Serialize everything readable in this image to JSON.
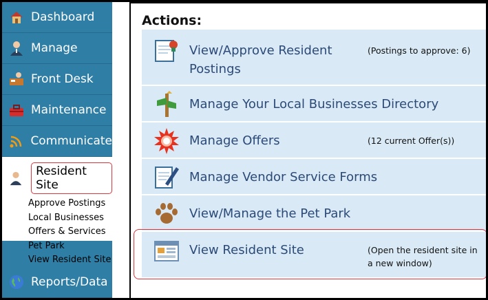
{
  "sidebar": {
    "items": [
      {
        "label": "Dashboard",
        "icon": "house-icon"
      },
      {
        "label": "Manage",
        "icon": "person-icon"
      },
      {
        "label": "Front Desk",
        "icon": "desk-icon"
      },
      {
        "label": "Maintenance",
        "icon": "toolbox-icon"
      },
      {
        "label": "Communicate",
        "icon": "wifi-icon"
      }
    ],
    "active": {
      "label": "Resident Site",
      "icon": "resident-icon",
      "sublinks": [
        "Approve Postings",
        "Local Businesses",
        "Offers & Services",
        "Pet Park",
        "View Resident Site"
      ]
    },
    "bottom": {
      "label": "Reports/Data",
      "icon": "globe-icon"
    }
  },
  "main": {
    "title": "Actions:",
    "cards": [
      {
        "line1": "View/Approve Resident",
        "line2": "Postings",
        "note1": "(Postings to approve: 6)",
        "note2": "",
        "icon": "notepad-icon"
      },
      {
        "line1": "Manage Your Local Businesses Directory",
        "line2": "",
        "note1": "",
        "note2": "",
        "icon": "signpost-icon"
      },
      {
        "line1": "Manage Offers",
        "line2": "",
        "note1": "(12 current Offer(s))",
        "note2": "",
        "icon": "starburst-icon"
      },
      {
        "line1": "Manage Vendor Service Forms",
        "line2": "",
        "note1": "",
        "note2": "",
        "icon": "form-pencil-icon"
      },
      {
        "line1": "View/Manage the Pet Park",
        "line2": "",
        "note1": "",
        "note2": "",
        "icon": "paw-icon"
      },
      {
        "line1": "View Resident Site",
        "line2": "",
        "note1": "(Open the resident site in",
        "note2": "a new window)",
        "icon": "website-icon"
      }
    ]
  },
  "colors": {
    "sidebar": "#2f7ea6",
    "card": "#d9eaf6",
    "link": "#2c4a77",
    "highlight": "#d9363e"
  }
}
